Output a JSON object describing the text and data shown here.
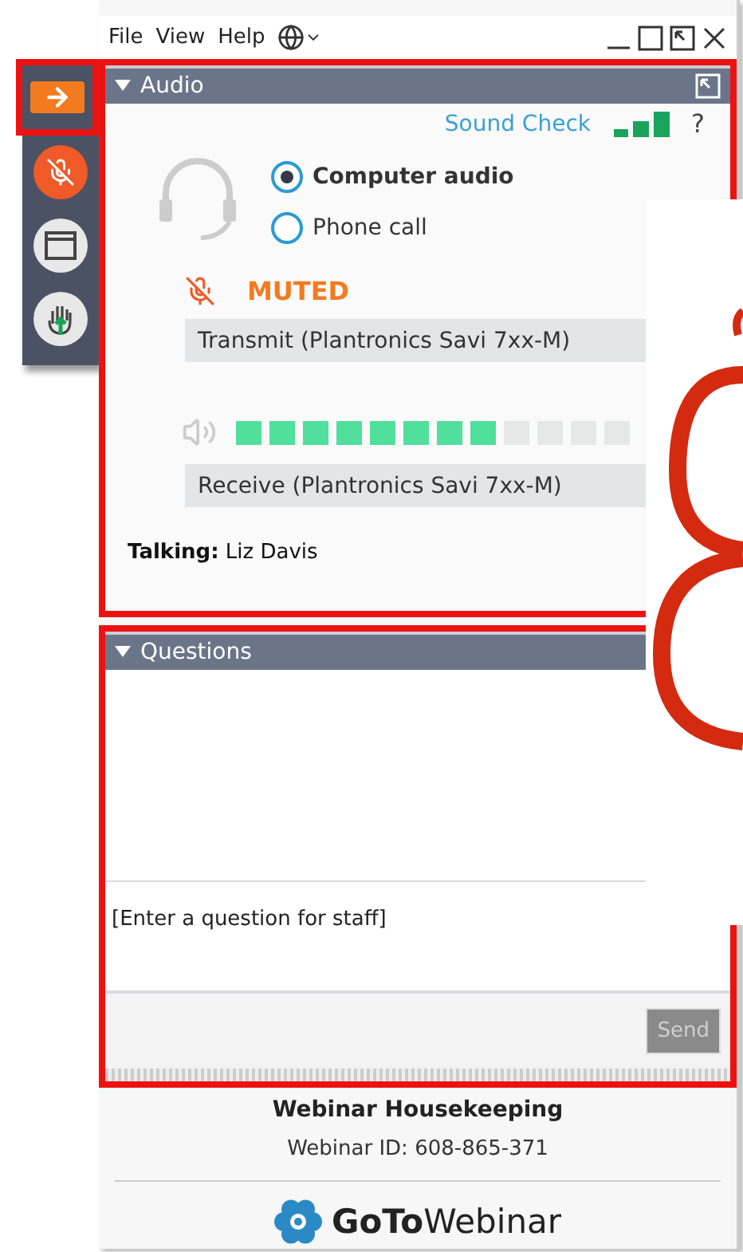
{
  "menu": [
    "File",
    "View",
    "Help"
  ],
  "audio": {
    "title": "Audio",
    "sound_check": "Sound Check",
    "help": "?",
    "options": [
      {
        "label": "Computer audio",
        "selected": true
      },
      {
        "label": "Phone call",
        "selected": false
      }
    ],
    "mute_status": "MUTED",
    "transmit_device": "Transmit (Plantronics Savi 7xx-M)",
    "speaker_meter": {
      "level": 0.67
    },
    "receive_device": "Receive (Plantronics Savi 7xx-M)",
    "talking": "**Talking:** Liz Davis"
  },
  "questions": {
    "title": "Questions",
    "placeholder": "[Enter a question for staff]",
    "send": {
      "label": "Send",
      "disabled": true
    }
  },
  "footer": {
    "title": "Webinar Housekeeping",
    "webinar_id": "Webinar ID: 608-865-371",
    "logo": "**GoTo**Webinar"
  }
}
